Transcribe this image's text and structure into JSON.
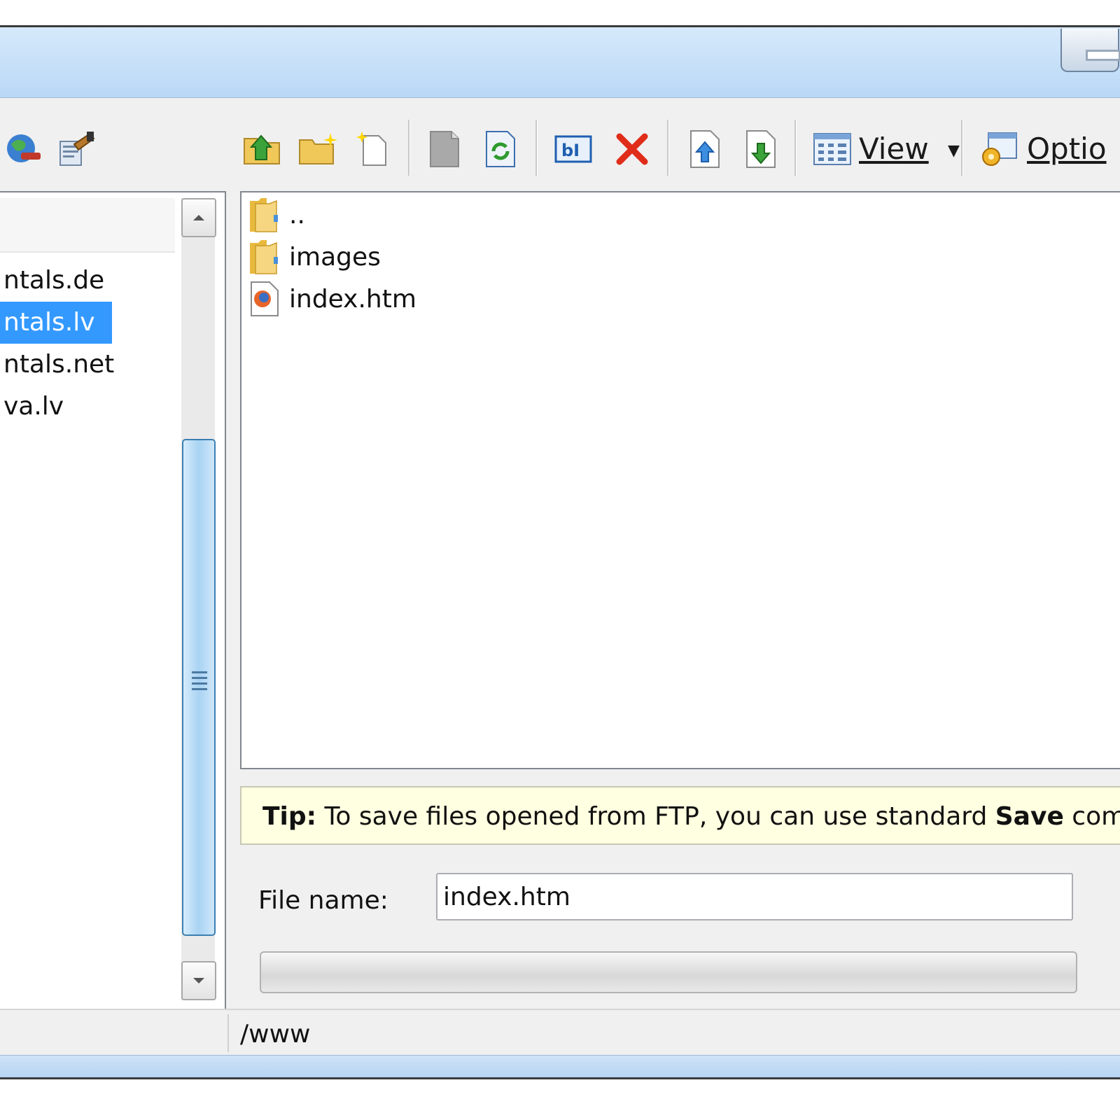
{
  "toolbar": {
    "view_label": "View",
    "options_label": "Optio"
  },
  "tree": {
    "items": [
      {
        "label": "ntals.de",
        "selected": false
      },
      {
        "label": "ntals.lv",
        "selected": true
      },
      {
        "label": "ntals.net",
        "selected": false
      },
      {
        "label": "va.lv",
        "selected": false
      }
    ]
  },
  "files": [
    {
      "name": "..",
      "icon": "folder-icon"
    },
    {
      "name": "images",
      "icon": "folder-icon"
    },
    {
      "name": "index.htm",
      "icon": "firefox-html-file-icon"
    }
  ],
  "tip": {
    "label": "Tip:",
    "text_before": " To save files opened from FTP, you can use standard ",
    "bold_word": "Save",
    "text_after": " comma"
  },
  "filename": {
    "label": "File name:",
    "value": "index.htm"
  },
  "status": {
    "path": "/www"
  },
  "colors": {
    "selection": "#3399ff",
    "tip_background": "#ffffe1",
    "titlebar": "#c6e0f8"
  }
}
